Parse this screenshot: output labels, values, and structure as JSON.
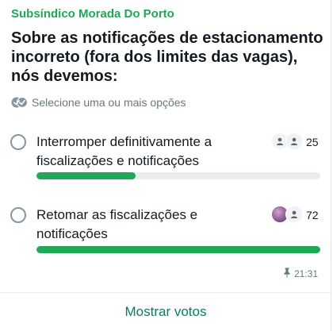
{
  "poll": {
    "sender": "Subsíndico Morada Do Porto",
    "question": "Sobre as notificações de estacionamento incorreto (fora dos limites das vagas), nós devemos:",
    "hint": "Selecione uma ou mais opções",
    "options": [
      {
        "label": "Interromper definitivamente a fiscalizações e notificações",
        "votes": "25",
        "fraction": 0.35,
        "voters": [
          "person-icon",
          "person-icon"
        ]
      },
      {
        "label": "Retomar as fiscalizações e notificações",
        "votes": "72",
        "fraction": 1.0,
        "voters": [
          "profile-photo",
          "person-icon"
        ]
      }
    ],
    "time": "21:31",
    "show_votes_label": "Mostrar votos"
  },
  "colors": {
    "accent": "#1fa855",
    "link": "#008069",
    "bar_track": "#e9edef",
    "muted": "#667781"
  }
}
